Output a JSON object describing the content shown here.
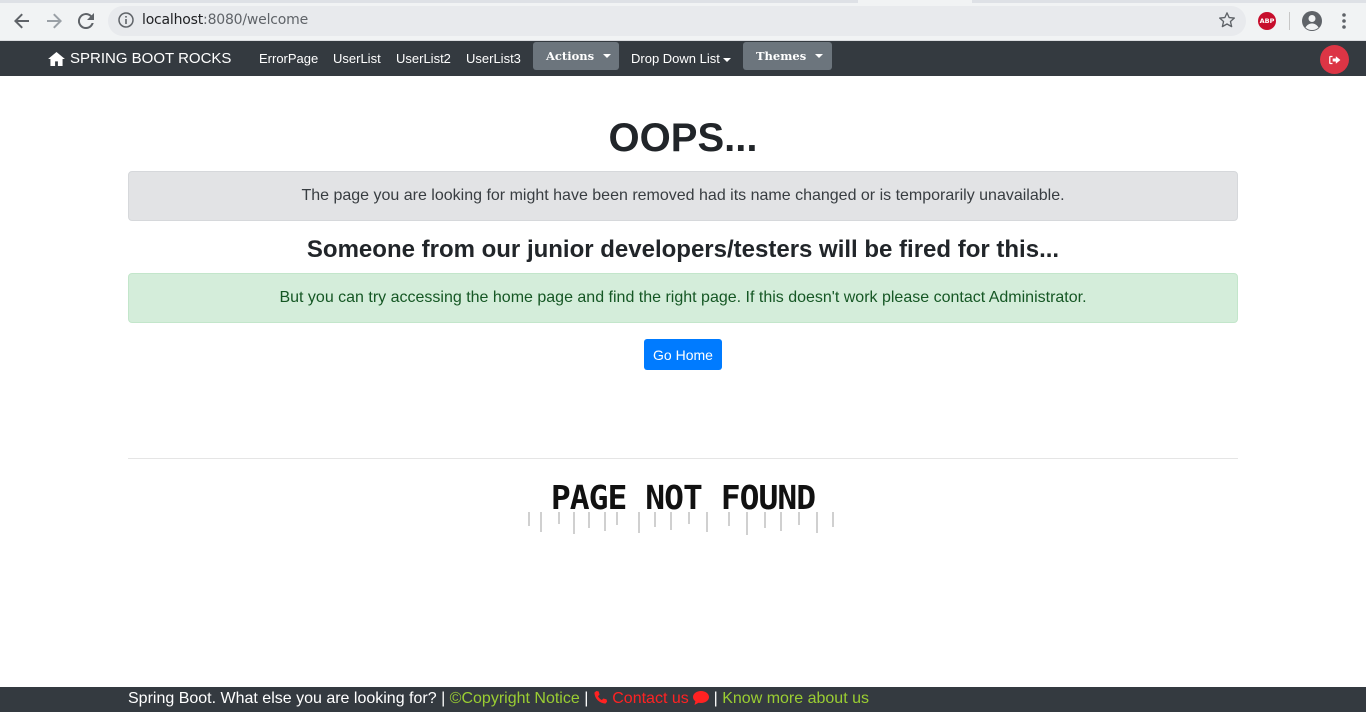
{
  "browser": {
    "url_host": "localhost",
    "url_rest": ":8080/welcome",
    "extension_label": "ABP"
  },
  "navbar": {
    "brand": "SPRING BOOT ROCKS",
    "links": [
      "ErrorPage",
      "UserList",
      "UserList2",
      "UserList3"
    ],
    "actions_label": "Actions",
    "dropdown_label": "Drop Down List",
    "themes_label": "Themes"
  },
  "main": {
    "title": "OOPS...",
    "message": "The page you are looking for might have been removed had its name changed or is temporarily unavailable.",
    "subtitle": "Someone from our junior developers/testers will be fired for this...",
    "hint": "But you can try accessing the home page and find the right page. If this doesn't work please contact Administrator.",
    "go_home_label": "Go Home",
    "image_text": "PAGE NOT FOUND"
  },
  "footer": {
    "prefix": "Spring Boot. What else you are looking for? | ",
    "copyright": "Copyright Notice",
    "contact": "Contact us",
    "know_more": "Know more about us"
  },
  "colors": {
    "navbar": "#343a40",
    "primary": "#007bff",
    "danger": "#dc3545",
    "footer_link": "#9acd32",
    "footer_contact": "#ff2222"
  }
}
